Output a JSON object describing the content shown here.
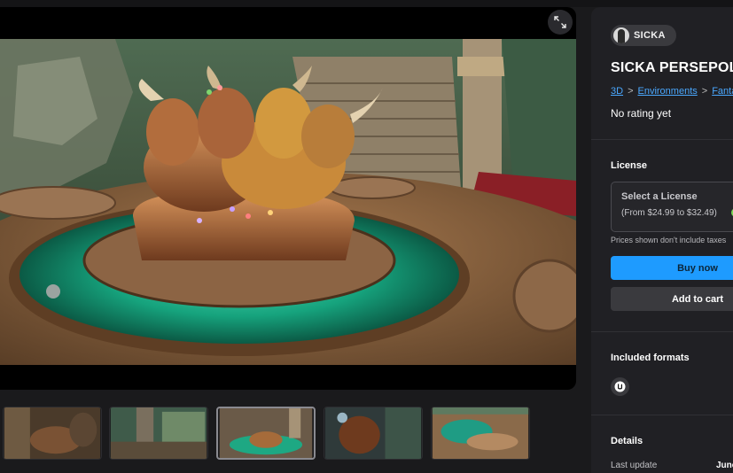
{
  "viewer": {
    "expand_icon": "expand-arrows-icon"
  },
  "thumbnails": [
    {
      "name": "thumbnail-1"
    },
    {
      "name": "thumbnail-2"
    },
    {
      "name": "thumbnail-3",
      "active": true
    },
    {
      "name": "thumbnail-4"
    },
    {
      "name": "thumbnail-5"
    }
  ],
  "product": {
    "seller": "SICKA",
    "title": "SICKA PERSEPOLI",
    "breadcrumbs": [
      "3D",
      "Environments",
      "Fanta"
    ],
    "rating": "No rating yet"
  },
  "license": {
    "heading": "License",
    "select_title": "Select a License",
    "price_range": "(From $24.99 to $32.49)",
    "tax_note": "Prices shown don't include taxes",
    "buy_now": "Buy now",
    "add_to_cart": "Add to cart"
  },
  "formats": {
    "heading": "Included formats",
    "icons": [
      "unreal-engine-icon"
    ]
  },
  "details": {
    "heading": "Details",
    "last_update_label": "Last update",
    "last_update_value": "June"
  },
  "colors": {
    "accent": "#1e9bff",
    "link": "#4aa8ff",
    "panel_bg": "#202024",
    "page_bg": "#1a1a1c"
  }
}
